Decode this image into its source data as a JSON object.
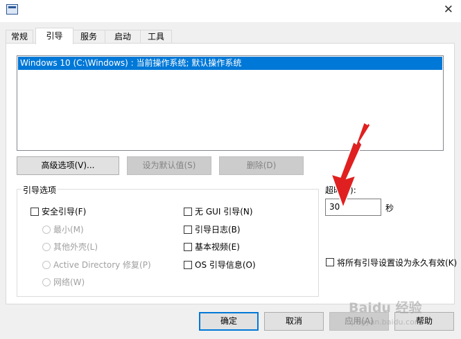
{
  "window": {
    "close_glyph": "✕"
  },
  "tabs": [
    "常规",
    "引导",
    "服务",
    "启动",
    "工具"
  ],
  "os_list": {
    "items": [
      "Windows 10 (C:\\Windows) : 当前操作系统; 默认操作系统"
    ],
    "selected_color": "#0078d7"
  },
  "os_buttons": {
    "advanced": "高级选项(V)...",
    "set_default": "设为默认值(S)",
    "delete": "删除(D)"
  },
  "boot_options": {
    "title": "引导选项",
    "safe_boot": "安全引导(F)",
    "radios": [
      "最小(M)",
      "其他外壳(L)",
      "Active Directory 修复(P)",
      "网络(W)"
    ],
    "right_checks": [
      "无 GUI 引导(N)",
      "引导日志(B)",
      "基本视频(E)",
      "OS 引导信息(O)"
    ]
  },
  "timeout": {
    "label": "超时(T):",
    "value": "30",
    "unit": "秒"
  },
  "make_permanent": "将所有引导设置设为永久有效(K)",
  "footer": {
    "ok": "确定",
    "cancel": "取消",
    "apply": "应用(A)",
    "help": "帮助"
  },
  "watermark": {
    "main": "Baidu 经验",
    "sub": "jingyan.baidu.com"
  },
  "colors": {
    "annotation_arrow": "#e02020",
    "accent": "#0078d7"
  },
  "icons": {
    "app": "msconfig-app-icon",
    "close": "close-icon",
    "annotation": "red-arrow-annotation"
  }
}
